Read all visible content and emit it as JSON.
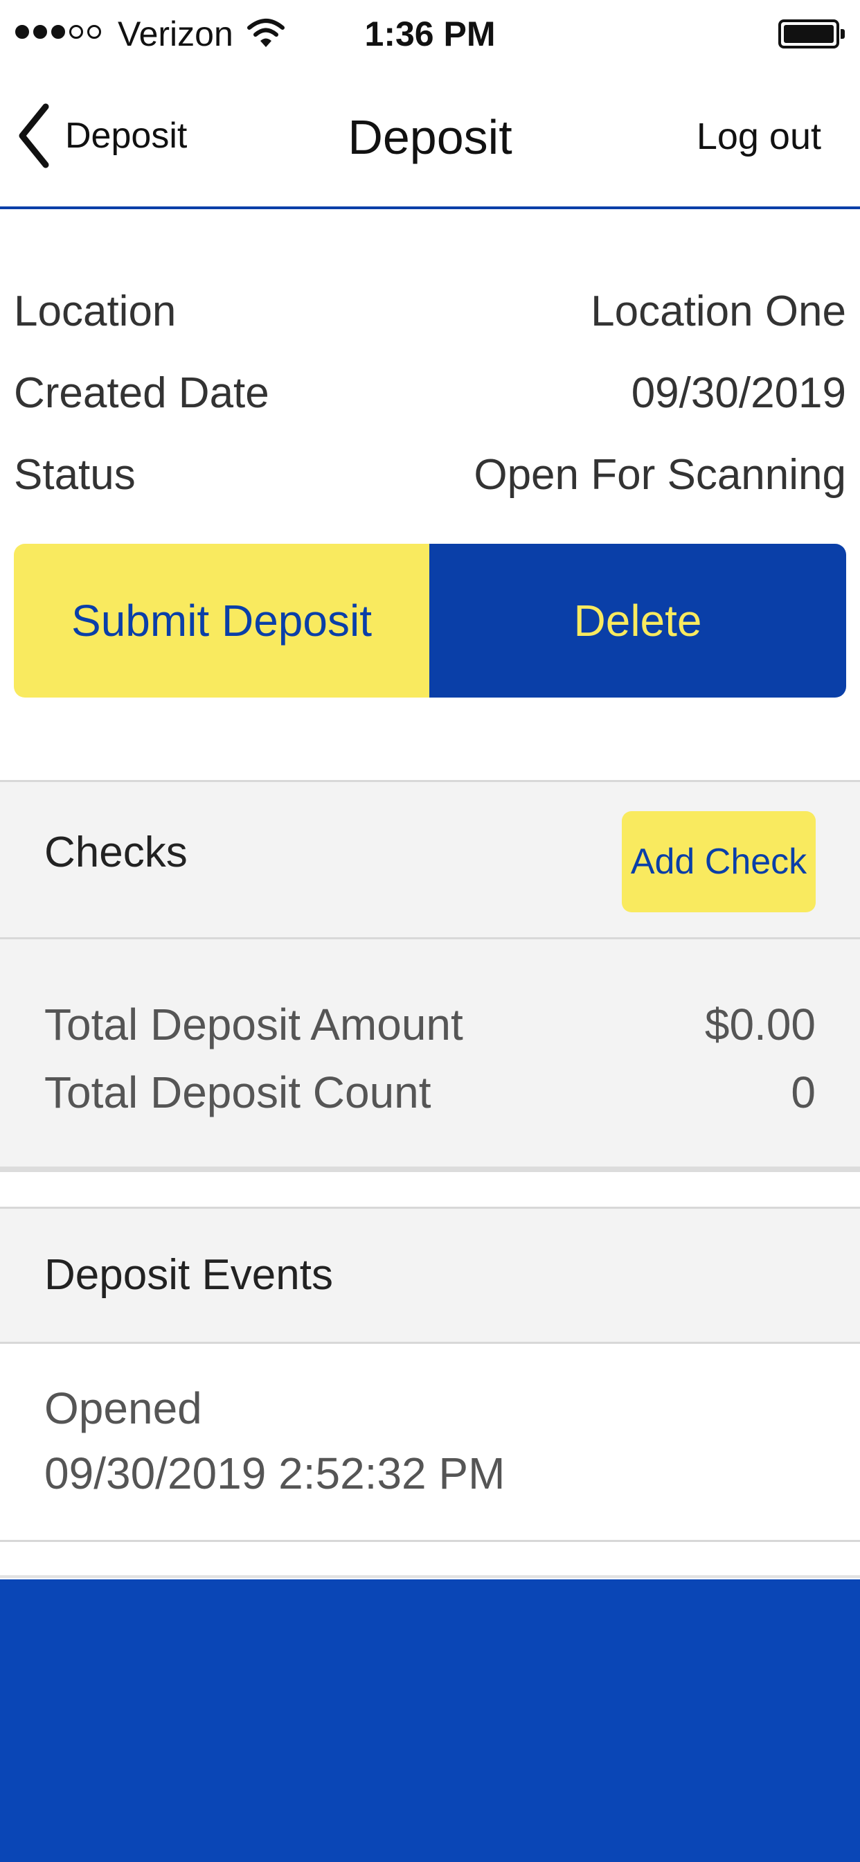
{
  "status_bar": {
    "carrier": "Verizon",
    "time": "1:36 PM",
    "signal_bars_filled": 3,
    "signal_bars_total": 5
  },
  "nav": {
    "back_label": "Deposit",
    "title": "Deposit",
    "logout_label": "Log out"
  },
  "info": {
    "rows": [
      {
        "label": "Location",
        "value": "Location One"
      },
      {
        "label": "Created Date",
        "value": "09/30/2019"
      },
      {
        "label": "Status",
        "value": "Open For Scanning"
      }
    ]
  },
  "actions": {
    "submit_label": "Submit Deposit",
    "delete_label": "Delete"
  },
  "checks": {
    "title": "Checks",
    "add_label": "Add Check",
    "total_amount_label": "Total Deposit Amount",
    "total_amount_value": "$0.00",
    "total_count_label": "Total Deposit Count",
    "total_count_value": "0"
  },
  "events": {
    "title": "Deposit Events",
    "items": [
      {
        "name": "Opened",
        "timestamp": "09/30/2019 2:52:32 PM"
      }
    ]
  },
  "colors": {
    "brand_blue": "#0a3fa8",
    "accent_yellow": "#f9ea5f",
    "footer_blue": "#0a46b6"
  }
}
